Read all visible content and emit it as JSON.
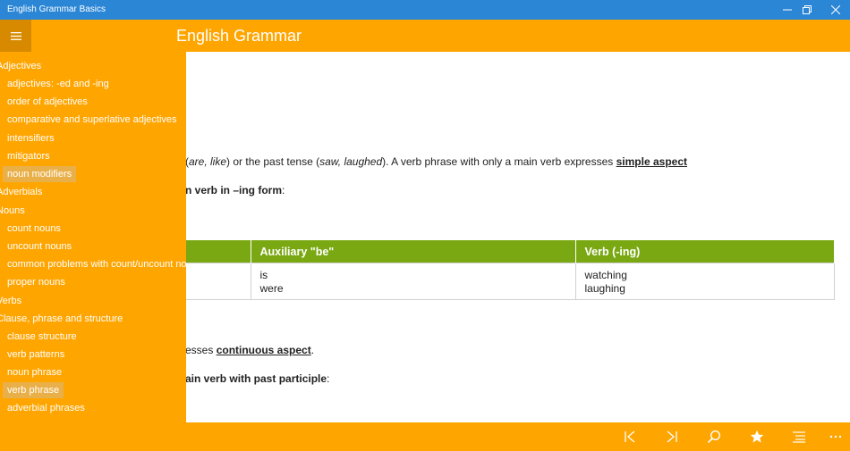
{
  "window": {
    "title": "English Grammar Basics",
    "controls": [
      "minimize",
      "restore",
      "close"
    ]
  },
  "app": {
    "title": "English Grammar"
  },
  "content": {
    "line1": {
      "pre": "(",
      "i1": "are, like",
      "mid1": ") or the past tense (",
      "i2": "saw, laughed",
      "mid2": "). A verb phrase with only a main verb expresses ",
      "b": "simple aspect"
    },
    "line2": {
      "b": "n verb in –ing form",
      "post": ":"
    },
    "table": {
      "headers": [
        "",
        "Auxiliary \"be\"",
        "Verb (-ing)"
      ],
      "rows": [
        {
          "c1": "",
          "c2a": "is",
          "c2b": "were",
          "c3a": "watching",
          "c3b": "laughing"
        }
      ]
    },
    "line3": {
      "pre": "esses ",
      "b": "continuous aspect",
      "post": "."
    },
    "line4": {
      "b": "ain verb with past participle",
      "post": ":"
    }
  },
  "sidebar": {
    "items": [
      {
        "label": "Adjectives",
        "type": "cat"
      },
      {
        "label": "adjectives: -ed and -ing",
        "type": "sub"
      },
      {
        "label": "order of adjectives",
        "type": "sub"
      },
      {
        "label": "comparative and superlative adjectives",
        "type": "sub"
      },
      {
        "label": "intensifiers",
        "type": "sub"
      },
      {
        "label": "mitigators",
        "type": "sub"
      },
      {
        "label": "noun modifiers",
        "type": "sub",
        "selected": true
      },
      {
        "label": "Adverbials",
        "type": "cat"
      },
      {
        "label": "Nouns",
        "type": "cat"
      },
      {
        "label": "count nouns",
        "type": "sub"
      },
      {
        "label": "uncount nouns",
        "type": "sub"
      },
      {
        "label": "common problems with count/uncount nouns",
        "type": "sub"
      },
      {
        "label": "proper nouns",
        "type": "sub"
      },
      {
        "label": "Verbs",
        "type": "cat"
      },
      {
        "label": "Clause, phrase and structure",
        "type": "cat"
      },
      {
        "label": "clause structure",
        "type": "sub"
      },
      {
        "label": "verb patterns",
        "type": "sub"
      },
      {
        "label": "noun phrase",
        "type": "sub"
      },
      {
        "label": "verb phrase",
        "type": "sub",
        "selected": true
      },
      {
        "label": "adverbial phrases",
        "type": "sub"
      }
    ]
  },
  "bottombar": {
    "icons": [
      "skip-start-icon",
      "skip-end-icon",
      "search-icon",
      "star-icon",
      "toc-icon",
      "more-icon"
    ]
  },
  "colors": {
    "accent": "#ffa500",
    "titlebar": "#2b86d6",
    "table_header": "#7aa812"
  }
}
